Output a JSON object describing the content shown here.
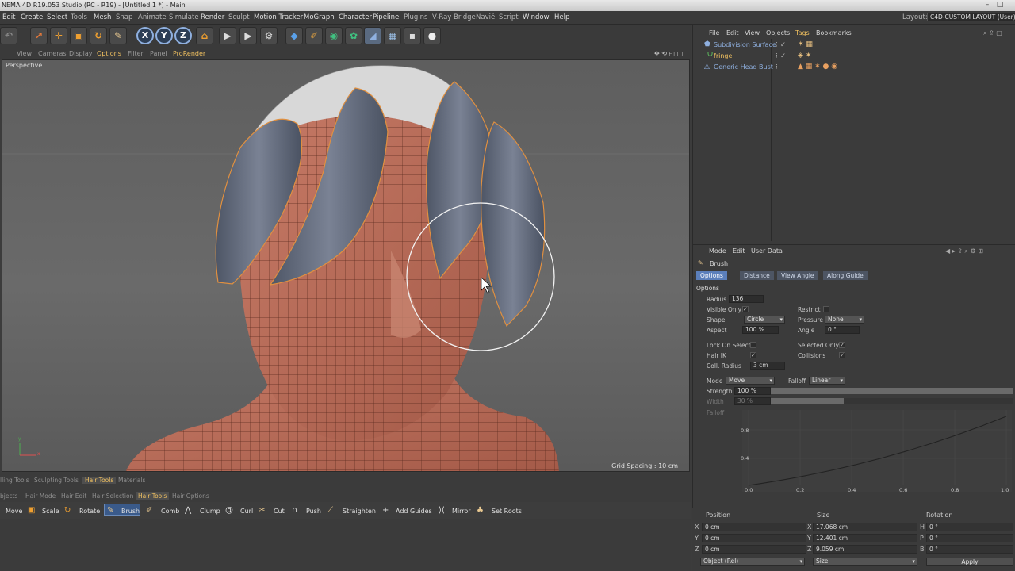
{
  "title_bar": {
    "text": "NEMA 4D R19.053 Studio (RC - R19) - [Untitled 1 *] - Main",
    "min": "–",
    "max": "□"
  },
  "menubar": {
    "items": [
      "Edit",
      "Create",
      "Select",
      "Tools",
      "Mesh",
      "Snap",
      "Animate",
      "Simulate",
      "Render",
      "Sculpt",
      "Motion Tracker",
      "MoGraph",
      "Character",
      "Pipeline",
      "Plugins",
      "V-Ray Bridge",
      "Navié",
      "Script",
      "Window",
      "Help"
    ],
    "layout_label": "Layout:",
    "layout_value": "C4D-CUSTOM LAYOUT (User)"
  },
  "toolbar": {
    "x_label": "X",
    "y_label": "Y",
    "z_label": "Z"
  },
  "viewport_menu": {
    "items": [
      "View",
      "Cameras",
      "Display",
      "Options",
      "Filter",
      "Panel",
      "ProRender"
    ],
    "active": "Options"
  },
  "viewport": {
    "label": "Perspective",
    "grid_spacing": "Grid Spacing : 10 cm",
    "axis_y": "y",
    "axis_x": "x"
  },
  "object_manager": {
    "menu": [
      "File",
      "Edit",
      "View",
      "Objects",
      "Tags",
      "Bookmarks"
    ],
    "active": "Tags",
    "objects": [
      {
        "name": "Subdivision Surface",
        "color": "#8fb0e0"
      },
      {
        "name": "fringe",
        "color": "#f0c060"
      },
      {
        "name": "Generic Head Bust",
        "color": "#8fb0e0"
      }
    ]
  },
  "attributes": {
    "menu": [
      "Mode",
      "Edit",
      "User Data"
    ],
    "tool_name": "Brush",
    "tabs": [
      "Options",
      "Distance",
      "View Angle",
      "Along Guide"
    ],
    "active_tab": "Options",
    "section": "Options",
    "radius_label": "Radius",
    "radius_value": "136",
    "visible_only_label": "Visible Only",
    "restrict_label": "Restrict",
    "shape_label": "Shape",
    "shape_value": "Circle",
    "pressure_label": "Pressure",
    "pressure_value": "None",
    "aspect_label": "Aspect",
    "aspect_value": "100 %",
    "angle_label": "Angle",
    "angle_value": "0 °",
    "lock_on_select_label": "Lock On Select",
    "selected_only_label": "Selected Only",
    "hair_ik_label": "Hair IK",
    "collisions_label": "Collisions",
    "coll_radius_label": "Coll. Radius",
    "coll_radius_value": "3 cm",
    "mode_label": "Mode",
    "mode_value": "Move",
    "falloff_label": "Falloff",
    "falloff_value": "Linear",
    "strength_label": "Strength",
    "strength_value": "100 %",
    "strength_level": 1.0,
    "width_label": "Width",
    "width_value": "30 %",
    "width_level": 0.3,
    "falloff_graph_label": "Falloff",
    "graph_y_ticks": [
      "0.8",
      "0.4"
    ],
    "graph_x_ticks": [
      "0.0",
      "0.2",
      "0.4",
      "0.6",
      "0.8",
      "1.0"
    ]
  },
  "bottom_panel": {
    "tabs_row1": [
      "lling Tools",
      "Sculpting Tools",
      "Hair Tools",
      "Materials"
    ],
    "tabs_row1_active": "Hair Tools",
    "tabs_row2": [
      "bjects",
      "Hair Mode",
      "Hair Edit",
      "Hair Selection",
      "Hair Tools",
      "Hair Options"
    ],
    "tabs_row2_active": "Hair Tools",
    "tools": [
      "Move",
      "Scale",
      "Rotate",
      "Brush",
      "Comb",
      "Clump",
      "Curl",
      "Cut",
      "Push",
      "Straighten",
      "Add Guides",
      "Mirror",
      "Set Roots"
    ],
    "active_tool": "Brush"
  },
  "coordinates": {
    "headers": [
      "Position",
      "Size",
      "Rotation"
    ],
    "rows": [
      {
        "axis": "X",
        "pos": "0 cm",
        "size_axis": "X",
        "size": "17.068 cm",
        "rot_axis": "H",
        "rot": "0 °"
      },
      {
        "axis": "Y",
        "pos": "0 cm",
        "size_axis": "Y",
        "size": "12.401 cm",
        "rot_axis": "P",
        "rot": "0 °"
      },
      {
        "axis": "Z",
        "pos": "0 cm",
        "size_axis": "Z",
        "size": "9.059 cm",
        "rot_axis": "B",
        "rot": "0 °"
      }
    ],
    "mode_value": "Object (Rel)",
    "size_mode_value": "Size",
    "apply_label": "Apply"
  }
}
